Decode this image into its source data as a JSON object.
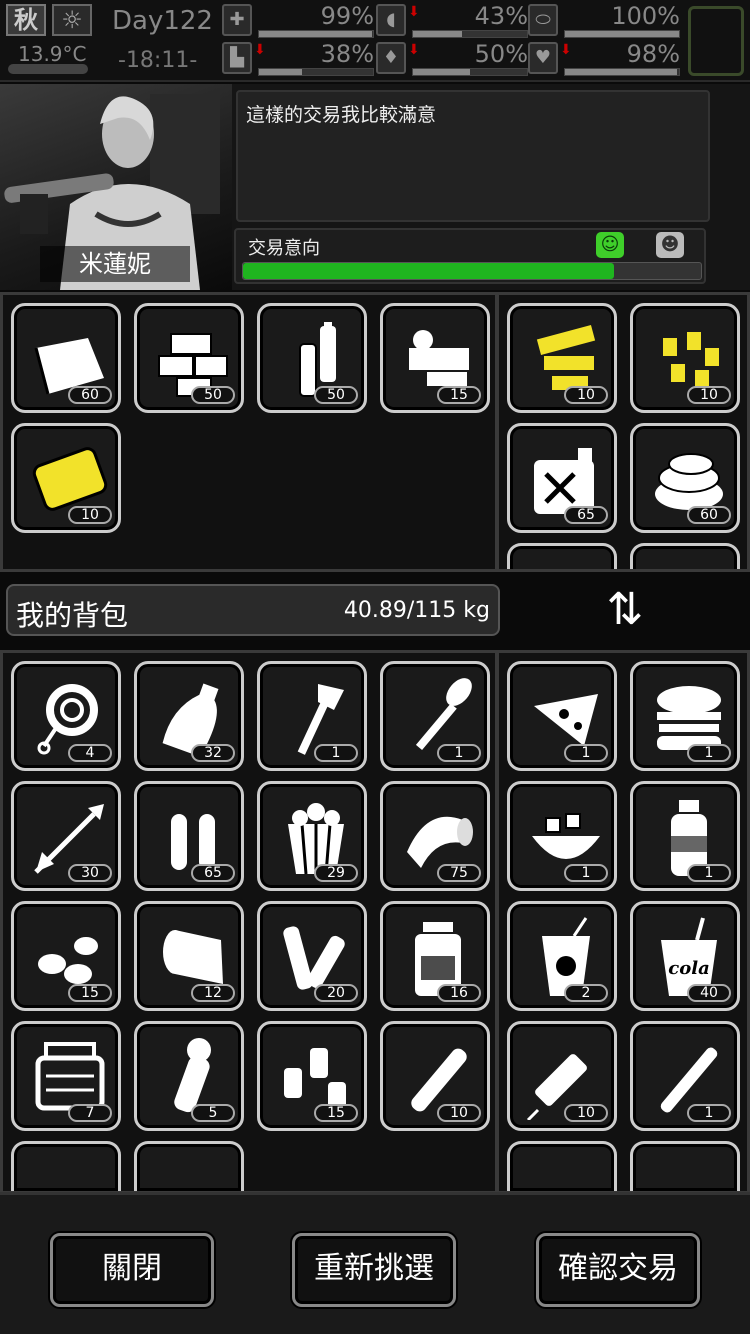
{
  "status": {
    "season": "秋",
    "sun_icon": "sun-icon",
    "temperature": "13.9°C",
    "day": "Day122",
    "time": "-18:11-",
    "stats": [
      {
        "name": "health",
        "icon": "medkit-icon",
        "value": "99%",
        "level": 0.99,
        "decreasing": false
      },
      {
        "name": "hunger",
        "icon": "stomach-icon",
        "value": "43%",
        "level": 0.43,
        "decreasing": true
      },
      {
        "name": "energy",
        "icon": "pill-icon",
        "value": "100%",
        "level": 1.0,
        "decreasing": false
      },
      {
        "name": "stamina",
        "icon": "boot-icon",
        "value": "38%",
        "level": 0.38,
        "decreasing": true
      },
      {
        "name": "thirst",
        "icon": "drop-icon",
        "value": "50%",
        "level": 0.5,
        "decreasing": true
      },
      {
        "name": "mood",
        "icon": "heart-icon",
        "value": "98%",
        "level": 0.98,
        "decreasing": true
      }
    ]
  },
  "npc": {
    "name": "米蓮妮",
    "dialog": "這樣的交易我比較滿意",
    "intent_label": "交易意向",
    "intent_level": 0.81
  },
  "npc_items": {
    "left": [
      {
        "icon": "cloth-icon",
        "qty": "60",
        "color": "#ffffff"
      },
      {
        "icon": "bricks-icon",
        "qty": "50",
        "color": "#ffffff"
      },
      {
        "icon": "battery-icon",
        "qty": "50",
        "color": "#ffffff"
      },
      {
        "icon": "machine-parts-icon",
        "qty": "15",
        "color": "#ffffff"
      },
      {
        "icon": "metal-plate-icon",
        "qty": "10",
        "color": "#f2e22a"
      }
    ],
    "right": [
      {
        "icon": "gun-parts-icon",
        "qty": "10",
        "color": "#f2e22a"
      },
      {
        "icon": "bullets-icon",
        "qty": "10",
        "color": "#f2e22a"
      },
      {
        "icon": "fuel-can-icon",
        "qty": "65",
        "color": "#ffffff"
      },
      {
        "icon": "fabric-pile-icon",
        "qty": "60",
        "color": "#ffffff"
      }
    ]
  },
  "bag": {
    "title": "我的背包",
    "weight": "40.89/115 kg",
    "left": [
      {
        "icon": "rope-icon",
        "qty": "4"
      },
      {
        "icon": "bottle-icon",
        "qty": "32"
      },
      {
        "icon": "hatchet-icon",
        "qty": "1"
      },
      {
        "icon": "shovel-icon",
        "qty": "1"
      },
      {
        "icon": "arrow-icon",
        "qty": "30"
      },
      {
        "icon": "ammo-icon",
        "qty": "65"
      },
      {
        "icon": "popcorn-icon",
        "qty": "29"
      },
      {
        "icon": "bandage-roll-icon",
        "qty": "75"
      },
      {
        "icon": "seeds-icon",
        "qty": "15"
      },
      {
        "icon": "cloth-roll-icon",
        "qty": "12"
      },
      {
        "icon": "pipes-icon",
        "qty": "20"
      },
      {
        "icon": "jar-icon",
        "qty": "16"
      },
      {
        "icon": "toolbox-icon",
        "qty": "7"
      },
      {
        "icon": "flashlight-icon",
        "qty": "5"
      },
      {
        "icon": "shotgun-shells-icon",
        "qty": "15"
      },
      {
        "icon": "cigar-icon",
        "qty": "10"
      }
    ],
    "right": [
      {
        "icon": "pizza-icon",
        "qty": "1"
      },
      {
        "icon": "burger-icon",
        "qty": "1"
      },
      {
        "icon": "salad-bowl-icon",
        "qty": "1"
      },
      {
        "icon": "soda-bottle-icon",
        "qty": "1"
      },
      {
        "icon": "lemonade-icon",
        "qty": "2"
      },
      {
        "icon": "cola-cup-icon",
        "qty": "40",
        "label": "cola"
      },
      {
        "icon": "syringe-icon",
        "qty": "10"
      },
      {
        "icon": "cigarette-icon",
        "qty": "1"
      }
    ]
  },
  "buttons": {
    "close": "關閉",
    "reselect": "重新挑選",
    "confirm": "確認交易"
  },
  "colors": {
    "accent_green": "#1fb51f",
    "highlight_yellow": "#f2e22a",
    "cell_border": "#cccccc"
  }
}
